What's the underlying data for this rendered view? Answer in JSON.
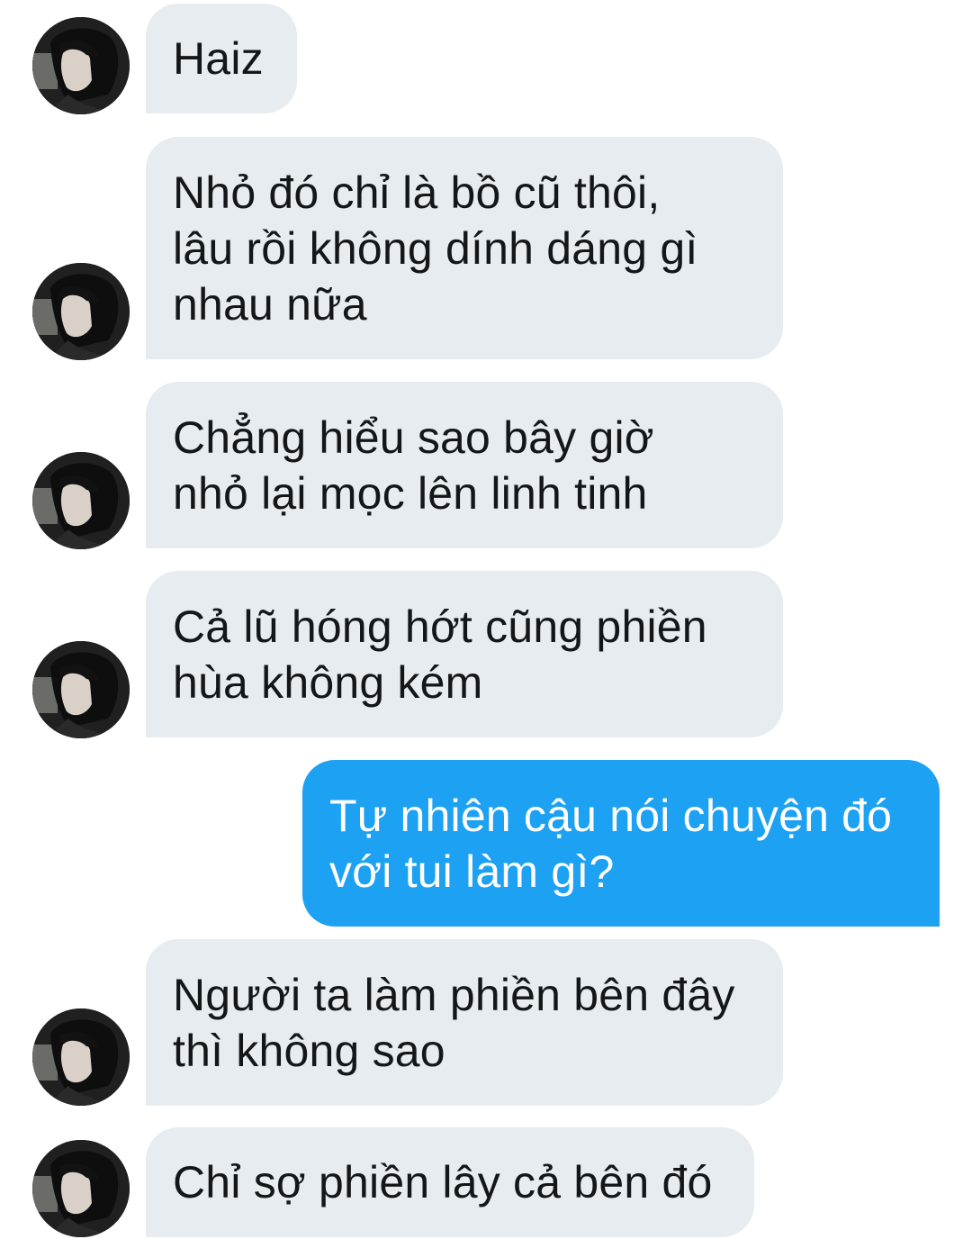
{
  "conversation": {
    "messages": [
      {
        "sender": "them",
        "text": "Haiz"
      },
      {
        "sender": "them",
        "text": "Nhỏ đó chỉ là bồ cũ thôi,\nlâu rồi không dính dáng gì\nnhau nữa"
      },
      {
        "sender": "them",
        "text": "Chẳng hiểu sao bây giờ\nnhỏ lại mọc lên linh tinh"
      },
      {
        "sender": "them",
        "text": "Cả lũ hóng hớt cũng phiền\nhùa không kém"
      },
      {
        "sender": "me",
        "text": "Tự nhiên cậu nói chuyện đó\nvới tui làm gì?"
      },
      {
        "sender": "them",
        "text": "Người ta làm phiền bên đây\nthì không sao"
      },
      {
        "sender": "them",
        "text": "Chỉ sợ phiền lây cả bên đó"
      }
    ]
  },
  "theme": {
    "incoming_bubble": "#e6ecf0",
    "incoming_text": "#14171a",
    "outgoing_bubble": "#1da1f2",
    "outgoing_text": "#ffffff",
    "avatar_icon": "user-avatar-photo"
  }
}
